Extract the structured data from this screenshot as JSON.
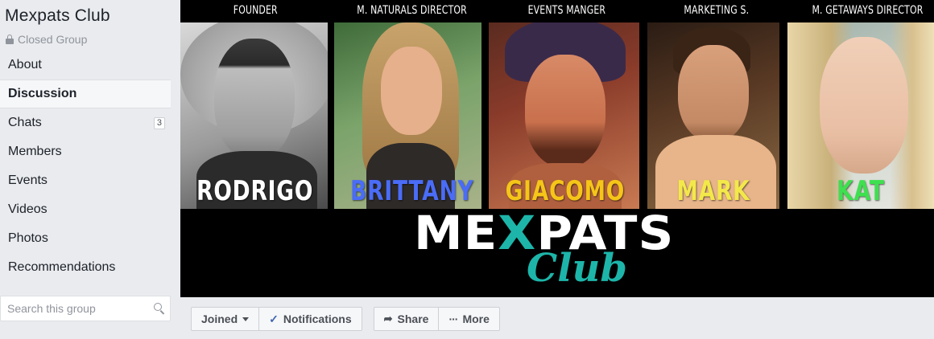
{
  "group": {
    "name": "Mexpats Club",
    "privacy": "Closed Group"
  },
  "sidebar": {
    "items": [
      {
        "label": "About"
      },
      {
        "label": "Discussion",
        "active": true
      },
      {
        "label": "Chats",
        "badge": "3"
      },
      {
        "label": "Members"
      },
      {
        "label": "Events"
      },
      {
        "label": "Videos"
      },
      {
        "label": "Photos"
      },
      {
        "label": "Recommendations"
      }
    ],
    "search_placeholder": "Search this group"
  },
  "cover": {
    "team": [
      {
        "role": "FOUNDER",
        "name": "RODRIGO",
        "name_color": "#ffffff"
      },
      {
        "role": "M. NATURALS DIRECTOR",
        "name": "BRITTANY",
        "name_color": "#4a6cf7"
      },
      {
        "role": "EVENTS MANGER",
        "name": "GIACOMO",
        "name_color": "#f5c518"
      },
      {
        "role": "MARKETING S.",
        "name": "MARK",
        "name_color": "#f3e84a"
      },
      {
        "role": "M. GETAWAYS DIRECTOR",
        "name": "KAT",
        "name_color": "#3ee04f"
      }
    ],
    "logo_main_left": "ME",
    "logo_x": "X",
    "logo_main_right": "PATS",
    "logo_sub": "Club",
    "accent": "#1db5a9"
  },
  "actions": {
    "joined": "Joined",
    "notifications": "Notifications",
    "share": "Share",
    "more": "More"
  }
}
